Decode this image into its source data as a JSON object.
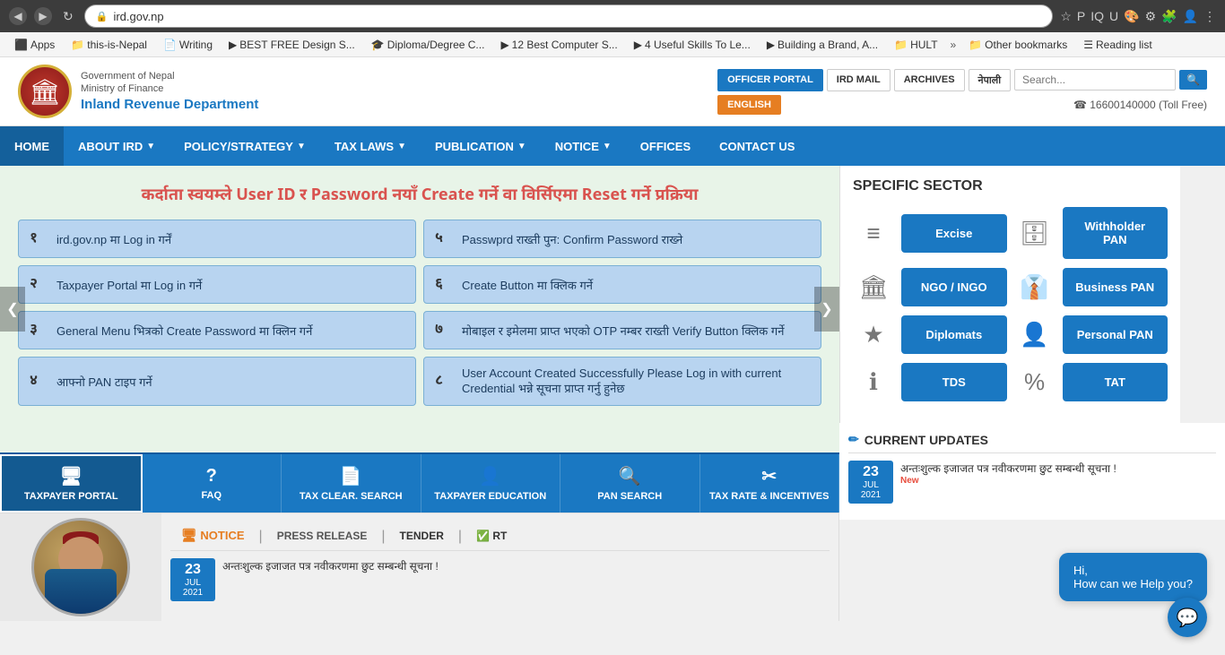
{
  "browser": {
    "url": "ird.gov.np",
    "nav_back": "◀",
    "nav_forward": "▶",
    "refresh": "↻",
    "lock": "🔒"
  },
  "bookmarks": {
    "items": [
      {
        "label": "Apps",
        "icon": "⬛"
      },
      {
        "label": "this-is-Nepal",
        "icon": "📁"
      },
      {
        "label": "Writing",
        "icon": "📄"
      },
      {
        "label": "BEST FREE Design S...",
        "icon": "▶"
      },
      {
        "label": "Diploma/Degree C...",
        "icon": "🎓"
      },
      {
        "label": "12 Best Computer S...",
        "icon": "▶"
      },
      {
        "label": "4 Useful Skills To Le...",
        "icon": "▶"
      },
      {
        "label": "Building a Brand, A...",
        "icon": "▶"
      },
      {
        "label": "HULT",
        "icon": "📁"
      },
      {
        "label": "»",
        "icon": ""
      },
      {
        "label": "Other bookmarks",
        "icon": "📁"
      },
      {
        "label": "Reading list",
        "icon": "☰"
      }
    ]
  },
  "header": {
    "gov_label": "Government of Nepal",
    "ministry_label": "Ministry of Finance",
    "dept_label": "Inland Revenue Department",
    "btn_officer": "OFFICER PORTAL",
    "btn_ird_mail": "IRD MAIL",
    "btn_archives": "ARCHIVES",
    "btn_nepali": "नेपाली",
    "btn_english": "ENGLISH",
    "search_placeholder": "Search...",
    "toll_free": "☎ 16600140000 (Toll Free)"
  },
  "nav": {
    "items": [
      {
        "label": "HOME"
      },
      {
        "label": "ABOUT IRD",
        "has_arrow": true
      },
      {
        "label": "POLICY/STRATEGY",
        "has_arrow": true
      },
      {
        "label": "TAX LAWS",
        "has_arrow": true
      },
      {
        "label": "PUBLICATION",
        "has_arrow": true
      },
      {
        "label": "NOTICE",
        "has_arrow": true
      },
      {
        "label": "OFFICES"
      },
      {
        "label": "CONTACT US"
      }
    ]
  },
  "slider": {
    "title": "कर्दाता स्वयम्ले User ID र Password नयाँ Create गर्ने वा विर्सिएमा Reset गर्ने प्रक्रिया",
    "steps": [
      {
        "num": "१",
        "text": "ird.gov.np मा Log in गर्नें"
      },
      {
        "num": "५",
        "text": "Passwprd राख्ती\nपुन: Confirm Password राख्ने"
      },
      {
        "num": "२",
        "text": "Taxpayer Portal मा Log in गर्ने"
      },
      {
        "num": "६",
        "text": "Create Button मा क्लिक गर्ने"
      },
      {
        "num": "३",
        "text": "General Menu भित्रको\nCreate Password मा क्लिन गर्ने"
      },
      {
        "num": "७",
        "text": "मोबाइल र इमेलमा प्राप्त भएको OTP नम्बर राख्ती Verify Button क्लिक गर्ने"
      },
      {
        "num": "४",
        "text": "आफ्नो PAN टाइप गर्ने"
      },
      {
        "num": "८",
        "text": "User Account Created Successfully Please Log in with current Credential भन्ने सूचना प्राप्त गर्नु हुनेछ"
      }
    ],
    "nav_left": "❮",
    "nav_right": "❯"
  },
  "quick_links": [
    {
      "label": "TAXPAYER PORTAL",
      "icon": "🖥",
      "active": true
    },
    {
      "label": "FAQ",
      "icon": "?"
    },
    {
      "label": "TAX CLEAR. SEARCH",
      "icon": "📄"
    },
    {
      "label": "TAXPAYER EDUCATION",
      "icon": "👤"
    },
    {
      "label": "PAN SEARCH",
      "icon": "🔍"
    },
    {
      "label": "TAX RATE & INCENTIVES",
      "icon": "✂"
    }
  ],
  "specific_sector": {
    "title": "SPECIFIC SECTOR",
    "sectors": [
      {
        "icon": "≡",
        "label": "Excise"
      },
      {
        "icon": "🗄",
        "label": "Withholder PAN"
      },
      {
        "icon": "🏛",
        "label": "NGO / INGO"
      },
      {
        "icon": "👔",
        "label": "Business PAN"
      },
      {
        "icon": "★",
        "label": "Diplomats"
      },
      {
        "icon": "👤",
        "label": "Personal PAN"
      },
      {
        "icon": "ℹ",
        "label": "TDS"
      },
      {
        "icon": "%",
        "label": "TAT"
      }
    ]
  },
  "news": {
    "tabs": [
      "NOTICE",
      "PRESS RELEASE",
      "TENDER",
      "RT"
    ],
    "items": [
      {
        "day": "23",
        "month": "JUL",
        "year": "2021",
        "text": "अन्तःशुल्क इजाजत पत्र नवीकरणमा छुट सम्बन्धी सूचना !"
      }
    ]
  },
  "current_updates": {
    "title": "CURRENT UPDATES",
    "items": [
      {
        "day": "23",
        "month": "JUL",
        "year": "2021",
        "text": "अन्तःशुल्क इजाजत पत्र नवीकरणमा छुट सम्बन्धी सूचना !",
        "is_new": true
      }
    ]
  },
  "chat": {
    "greeting": "Hi,",
    "message": "How can we Help you?"
  }
}
